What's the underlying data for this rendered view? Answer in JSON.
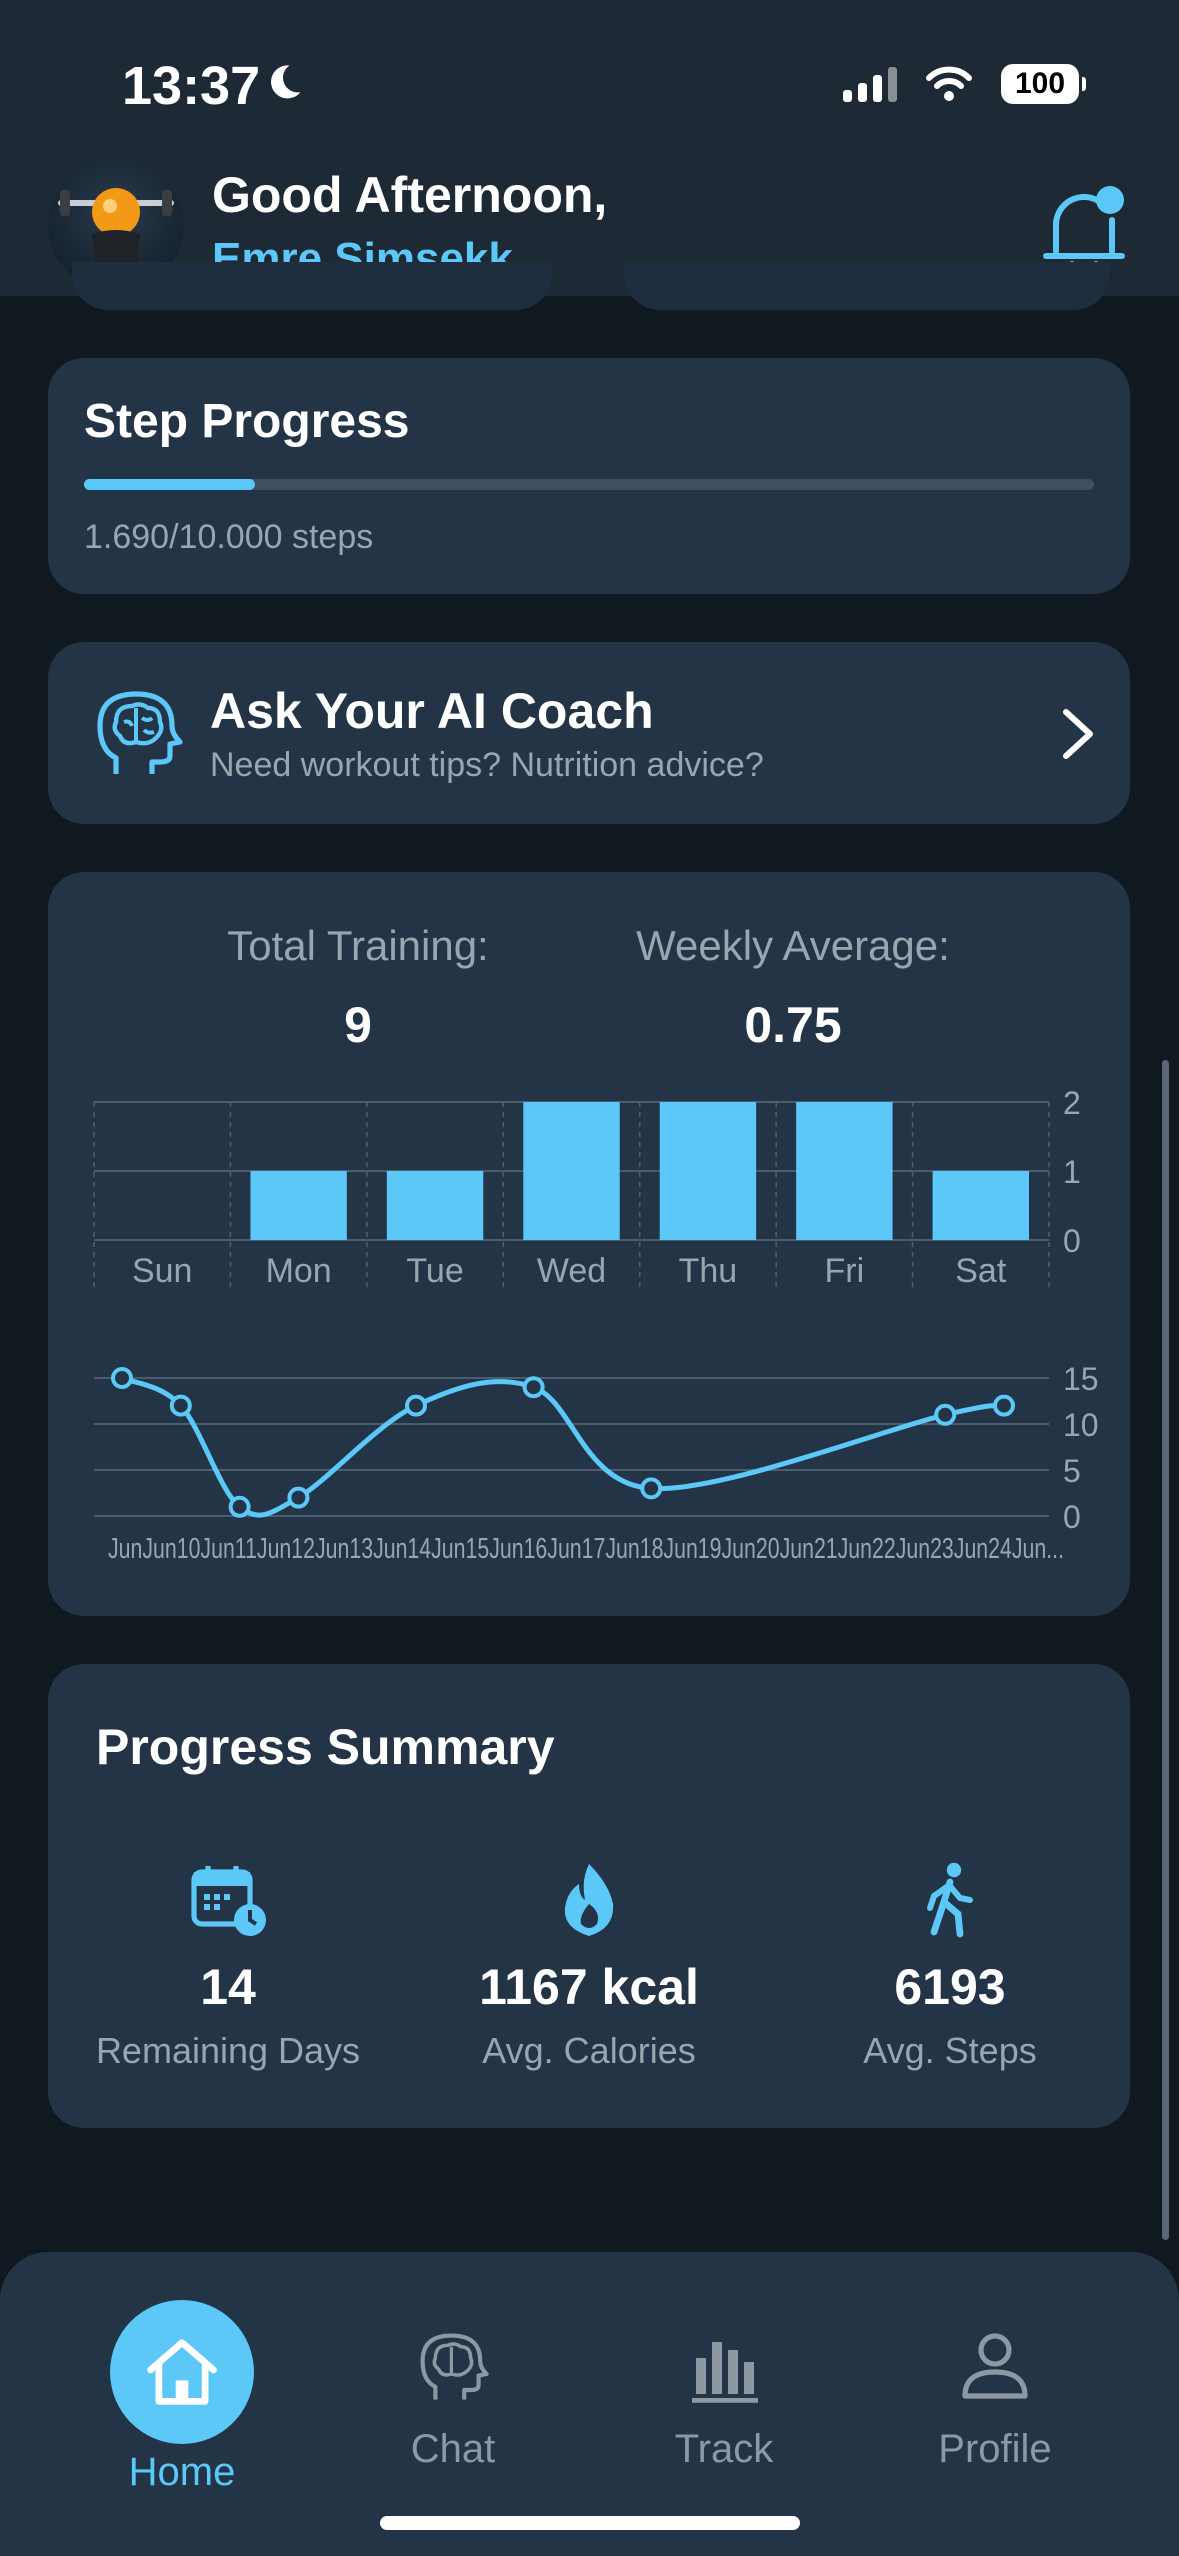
{
  "status_bar": {
    "time": "13:37",
    "battery": "100"
  },
  "header": {
    "greeting": "Good Afternoon,",
    "username": "Emre Simsekk"
  },
  "step_progress": {
    "title": "Step Progress",
    "text": "1.690/10.000 steps",
    "progress": 0.169
  },
  "ai_coach": {
    "title": "Ask Your AI Coach",
    "subtitle": "Need workout tips? Nutrition advice?"
  },
  "training": {
    "total_label": "Total Training:",
    "total_value": "9",
    "avg_label": "Weekly Average:",
    "avg_value": "0.75"
  },
  "chart_data": [
    {
      "type": "bar",
      "categories": [
        "Sun",
        "Mon",
        "Tue",
        "Wed",
        "Thu",
        "Fri",
        "Sat"
      ],
      "values": [
        0,
        1,
        1,
        2,
        2,
        2,
        1
      ],
      "ylim": [
        0,
        2
      ],
      "yticks": [
        0,
        1,
        2
      ],
      "grid": true,
      "color": "#5bc8f8"
    },
    {
      "type": "line",
      "x": [
        "Jun 10",
        "Jun 11",
        "Jun 12",
        "Jun 13",
        "Jun 14",
        "Jun 15",
        "Jun 16",
        "Jun 17",
        "Jun 18",
        "Jun 19",
        "Jun 20",
        "Jun 21",
        "Jun 22",
        "Jun 23",
        "Jun 24",
        "Jun..."
      ],
      "xtick_text": "JunJun10Jun11Jun12Jun13Jun14Jun15Jun16Jun17Jun18Jun19Jun20Jun21Jun22Jun23Jun24Jun...",
      "points": [
        {
          "x": "Jun 10",
          "y": 15
        },
        {
          "x": "Jun 11",
          "y": 12
        },
        {
          "x": "Jun 12",
          "y": 1
        },
        {
          "x": "Jun 13",
          "y": 2
        },
        {
          "x": "Jun 15",
          "y": 12
        },
        {
          "x": "Jun 17",
          "y": 14
        },
        {
          "x": "Jun 19",
          "y": 3
        },
        {
          "x": "Jun 24",
          "y": 11
        },
        {
          "x": "Jun...",
          "y": 12
        }
      ],
      "ylim": [
        0,
        15
      ],
      "yticks": [
        0,
        5,
        10,
        15
      ],
      "grid": true,
      "color": "#5bc8f8"
    }
  ],
  "summary": {
    "title": "Progress Summary",
    "items": [
      {
        "icon": "calendar-clock-icon",
        "value": "14",
        "label": "Remaining Days"
      },
      {
        "icon": "flame-icon",
        "value": "1167 kcal",
        "label": "Avg. Calories"
      },
      {
        "icon": "walking-icon",
        "value": "6193",
        "label": "Avg. Steps"
      }
    ]
  },
  "tabs": [
    {
      "label": "Home",
      "icon": "home-icon",
      "active": true
    },
    {
      "label": "Chat",
      "icon": "brain-icon",
      "active": false
    },
    {
      "label": "Track",
      "icon": "bar-chart-icon",
      "active": false
    },
    {
      "label": "Profile",
      "icon": "person-icon",
      "active": false
    }
  ],
  "colors": {
    "accent": "#5bc8f8",
    "card": "#223446",
    "background": "#101820",
    "muted_text": "#9aa5b0"
  }
}
